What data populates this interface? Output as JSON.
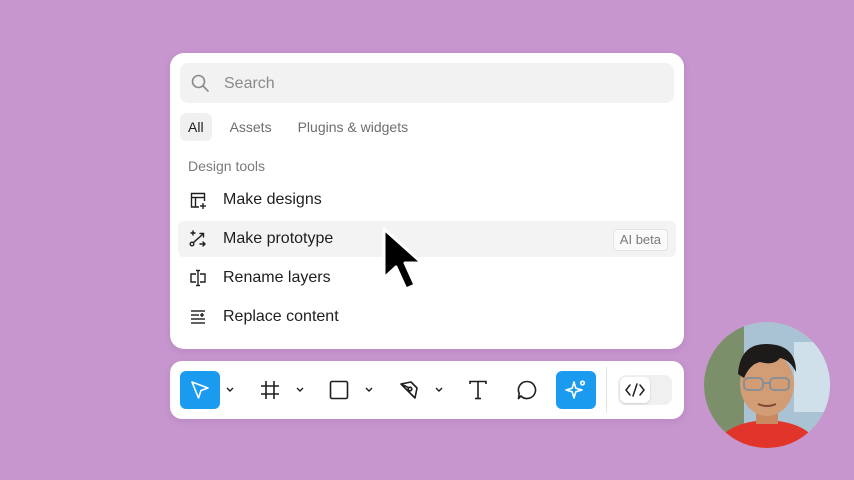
{
  "search": {
    "placeholder": "Search",
    "icon": "search-icon"
  },
  "tabs": [
    {
      "label": "All",
      "active": true
    },
    {
      "label": "Assets",
      "active": false
    },
    {
      "label": "Plugins & widgets",
      "active": false
    }
  ],
  "section": {
    "label": "Design tools"
  },
  "items": [
    {
      "label": "Make designs",
      "icon": "layout-plus-icon"
    },
    {
      "label": "Make prototype",
      "icon": "prototype-icon",
      "badge": "AI beta",
      "highlighted": true
    },
    {
      "label": "Rename layers",
      "icon": "rename-icon"
    },
    {
      "label": "Replace content",
      "icon": "replace-content-icon"
    }
  ],
  "toolbar": {
    "tools": [
      "move-tool",
      "frame-tool",
      "rectangle-tool",
      "pen-tool",
      "text-tool",
      "comment-tool",
      "ai-actions-tool"
    ],
    "active_tool": "move-tool",
    "accent_color": "#1a9bf0",
    "dev_mode_icon": "code-icon"
  },
  "colors": {
    "background": "#c796cf",
    "panel": "#ffffff",
    "accent": "#1a9bf0"
  }
}
